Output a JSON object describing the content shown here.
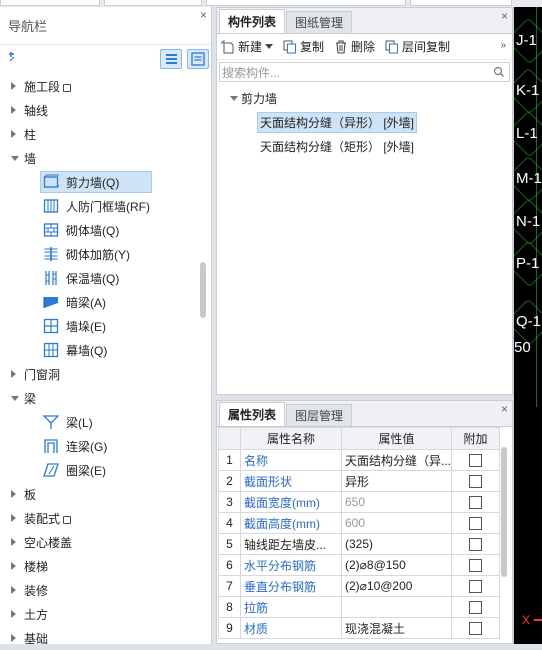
{
  "nav": {
    "title": "导航栏",
    "close": "×",
    "items": [
      {
        "label": "施工段",
        "lock": true
      },
      {
        "label": "轴线"
      },
      {
        "label": "柱"
      },
      {
        "label": "墙"
      },
      {
        "label": "剪力墙(Q)"
      },
      {
        "label": "人防门框墙(RF)"
      },
      {
        "label": "砌体墙(Q)"
      },
      {
        "label": "砌体加筋(Y)"
      },
      {
        "label": "保温墙(Q)"
      },
      {
        "label": "暗梁(A)"
      },
      {
        "label": "墙垛(E)"
      },
      {
        "label": "幕墙(Q)"
      },
      {
        "label": "门窗洞"
      },
      {
        "label": "梁"
      },
      {
        "label": "梁(L)"
      },
      {
        "label": "连梁(G)"
      },
      {
        "label": "圈梁(E)"
      },
      {
        "label": "板"
      },
      {
        "label": "装配式",
        "lock": true
      },
      {
        "label": "空心楼盖"
      },
      {
        "label": "楼梯"
      },
      {
        "label": "装修"
      },
      {
        "label": "土方"
      },
      {
        "label": "基础"
      }
    ]
  },
  "component_panel": {
    "tabs": [
      "构件列表",
      "图纸管理"
    ],
    "close": "×",
    "toolbar": {
      "new": "新建",
      "copy": "复制",
      "delete": "删除",
      "floor_copy": "层间复制",
      "more": "»"
    },
    "search_placeholder": "搜索构件...",
    "tree": {
      "group": "剪力墙",
      "items": [
        "天面结构分缝（异形）  [外墙]",
        "天面结构分缝（矩形）  [外墙]"
      ]
    }
  },
  "property_panel": {
    "tabs": [
      "属性列表",
      "图层管理"
    ],
    "close": "×",
    "columns": [
      "属性名称",
      "属性值",
      "附加"
    ],
    "rows": [
      {
        "n": "1",
        "name": "名称",
        "value": "天面结构分缝（异..."
      },
      {
        "n": "2",
        "name": "截面形状",
        "value": "异形"
      },
      {
        "n": "3",
        "name": "截面宽度(mm)",
        "value": "650"
      },
      {
        "n": "4",
        "name": "截面高度(mm)",
        "value": "600"
      },
      {
        "n": "5",
        "name": "轴线距左墙皮...",
        "value": "(325)"
      },
      {
        "n": "6",
        "name": "水平分布钢筋",
        "value": "(2)⌀8@150"
      },
      {
        "n": "7",
        "name": "垂直分布钢筋",
        "value": "(2)⌀10@200"
      },
      {
        "n": "8",
        "name": "拉筋",
        "value": ""
      },
      {
        "n": "9",
        "name": "材质",
        "value": "现浇混凝土"
      }
    ]
  },
  "canvas": {
    "axis_labels": [
      "J-1",
      "K-1",
      "L-1",
      "M-1",
      "N-1",
      "P-1",
      "Q-1"
    ],
    "dimension": "50",
    "axis_marker": "X"
  },
  "colors": {
    "accent": "#2a7ad6",
    "selection": "#cfe3f7",
    "property_name": "#2a6bd1",
    "canvas_bg": "#000000",
    "axis_red": "#ff3333"
  }
}
